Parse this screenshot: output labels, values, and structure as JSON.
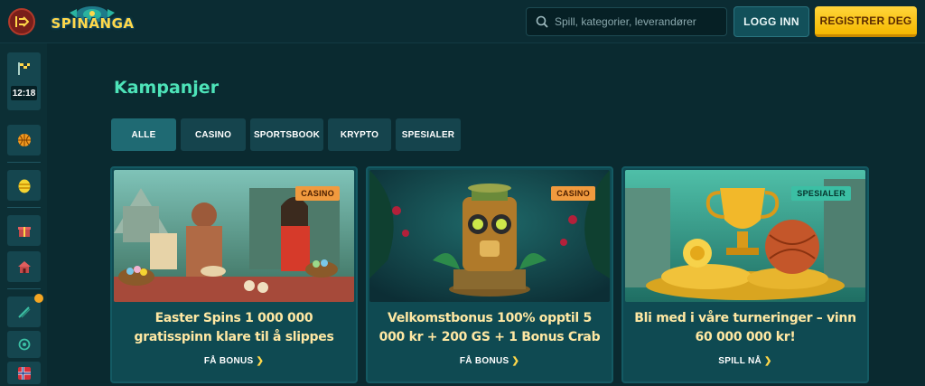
{
  "header": {
    "logo_text": "SPINANGA",
    "search_placeholder": "Spill, kategorier, leverandører",
    "login_label": "LOGG INN",
    "register_label": "REGISTRER DEG"
  },
  "sidebar": {
    "timer": "12:18",
    "icons": [
      "checkered-flag-icon",
      "basketball-icon",
      "easter-egg-icon",
      "gift-icon",
      "house-icon",
      "tournament-flag-icon",
      "medal-icon",
      "flag-norway-icon"
    ]
  },
  "main": {
    "title": "Kampanjer",
    "filters": [
      "ALLE",
      "CASINO",
      "SPORTSBOOK",
      "KRYPTO",
      "SPESIALER"
    ],
    "active_filter": "ALLE",
    "cards": [
      {
        "badge": "CASINO",
        "title": "Easter Spins 1 000 000 gratisspinn klare til å slippes",
        "cta": "FÅ BONUS"
      },
      {
        "badge": "CASINO",
        "title": "Velkomstbonus 100% opptil 5 000 kr + 200 GS + 1 Bonus Crab",
        "cta": "FÅ BONUS"
      },
      {
        "badge": "SPESIALER",
        "title": "Bli med i våre turneringer – vinn 60 000 000 kr!",
        "cta": "SPILL NÅ"
      }
    ]
  },
  "colors": {
    "background": "#0a2a30",
    "accent_title": "#4de3b8",
    "register_button": "#ffd53a",
    "login_button": "#12505a",
    "card_title": "#ffe8a3",
    "badge_casino": "#f19a3e",
    "badge_special": "#3bbfa4"
  }
}
